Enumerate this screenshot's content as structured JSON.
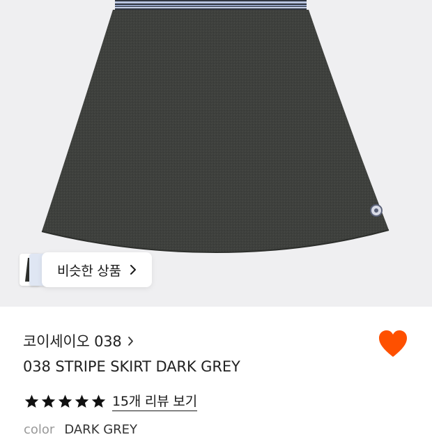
{
  "product": {
    "brand": "코이세이오 038",
    "title": "038 STRIPE SKIRT DARK GREY",
    "rating_stars": 5,
    "review_link": "15개 리뷰 보기",
    "color_label": "color",
    "color_value": "DARK GREY",
    "favorited": true
  },
  "gallery": {
    "similar_button_label": "비슷한 상품"
  },
  "colors": {
    "heart": "#fe5000",
    "skirt": "#3e403d",
    "waistband": "#9aa8c8",
    "background": "#efeff1"
  },
  "icons": [
    "chevron-right-icon",
    "heart-icon",
    "star-icon"
  ]
}
